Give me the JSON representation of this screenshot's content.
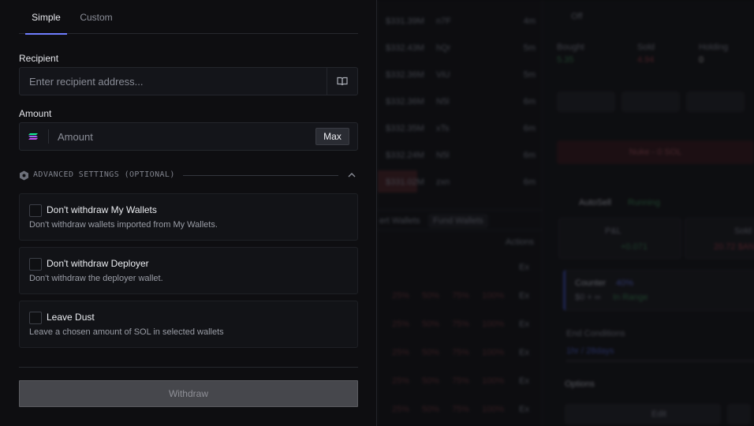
{
  "tabs": {
    "simple": "Simple",
    "custom": "Custom"
  },
  "recipient": {
    "label": "Recipient",
    "placeholder": "Enter recipient address...",
    "icon": "book-icon"
  },
  "amount": {
    "label": "Amount",
    "placeholder": "Amount",
    "max_label": "Max",
    "token_icon": "solana-icon"
  },
  "advanced": {
    "label": "ADVANCED SETTINGS (OPTIONAL)",
    "icon": "hexagon-gear-icon",
    "toggle_icon": "chevron-up-icon"
  },
  "options": [
    {
      "title": "Don't withdraw My Wallets",
      "desc": "Don't withdraw wallets imported from My Wallets.",
      "checked": false
    },
    {
      "title": "Don't withdraw Deployer",
      "desc": "Don't withdraw the deployer wallet.",
      "checked": false
    },
    {
      "title": "Leave Dust",
      "desc": "Leave a chosen amount of SOL in selected wallets",
      "checked": false
    }
  ],
  "withdraw_label": "Withdraw",
  "background": {
    "trades": [
      {
        "mc": "$331.39M",
        "addr": "n7F",
        "age": "4m"
      },
      {
        "mc": "$332.43M",
        "addr": "hQr",
        "age": "5m"
      },
      {
        "mc": "$332.36M",
        "addr": "ViU",
        "age": "5m"
      },
      {
        "mc": "$332.36M",
        "addr": "N5l",
        "age": "6m"
      },
      {
        "mc": "$332.35M",
        "addr": "xTs",
        "age": "6m"
      },
      {
        "mc": "$332.24M",
        "addr": "N5l",
        "age": "6m"
      },
      {
        "mc": "$331.02M",
        "addr": "zxn",
        "age": "6m"
      }
    ],
    "wallet_tabs": [
      "ert Wallets",
      "Fund Wallets"
    ],
    "actions_label": "Actions",
    "off_label": "Off",
    "stats": [
      {
        "label": "Bought",
        "value": "5.35"
      },
      {
        "label": "Sold",
        "value": "4.94"
      },
      {
        "label": "Holding",
        "value": "0"
      }
    ],
    "nuke_label": "Nuke - 0 SOL",
    "autosell": {
      "label": "AutoSell",
      "status": "Running",
      "pnl_label": "P&L",
      "pnl_value": "+0.071",
      "sold_label": "Sold",
      "sold_value": "20.72 $AN"
    },
    "counter": {
      "label": "Counter",
      "pct": "40%",
      "range": "$0 + ∞",
      "status": "In Range"
    },
    "end_conditions": {
      "label": "End Conditions",
      "value": "1hr / 28days"
    },
    "options_label": "Options",
    "edit_label": "Edit",
    "ex_label": "Ex"
  }
}
